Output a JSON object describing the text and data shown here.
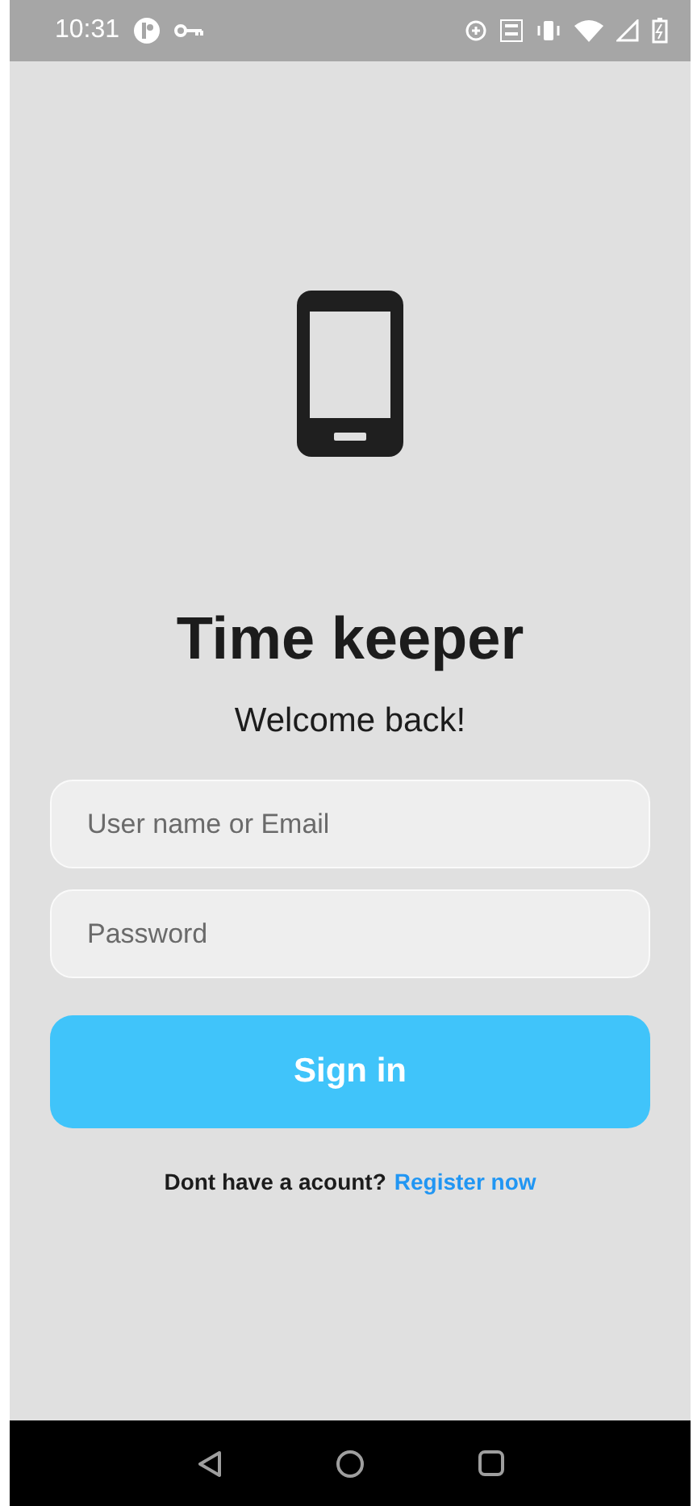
{
  "status_bar": {
    "time": "10:31"
  },
  "app": {
    "title": "Time keeper",
    "subtitle": "Welcome back!"
  },
  "form": {
    "fields": [
      {
        "placeholder": "User name or Email"
      },
      {
        "placeholder": "Password"
      }
    ],
    "submit": "Sign in",
    "footer": {
      "prompt": "Dont have a acount?",
      "link": "Register now"
    }
  }
}
